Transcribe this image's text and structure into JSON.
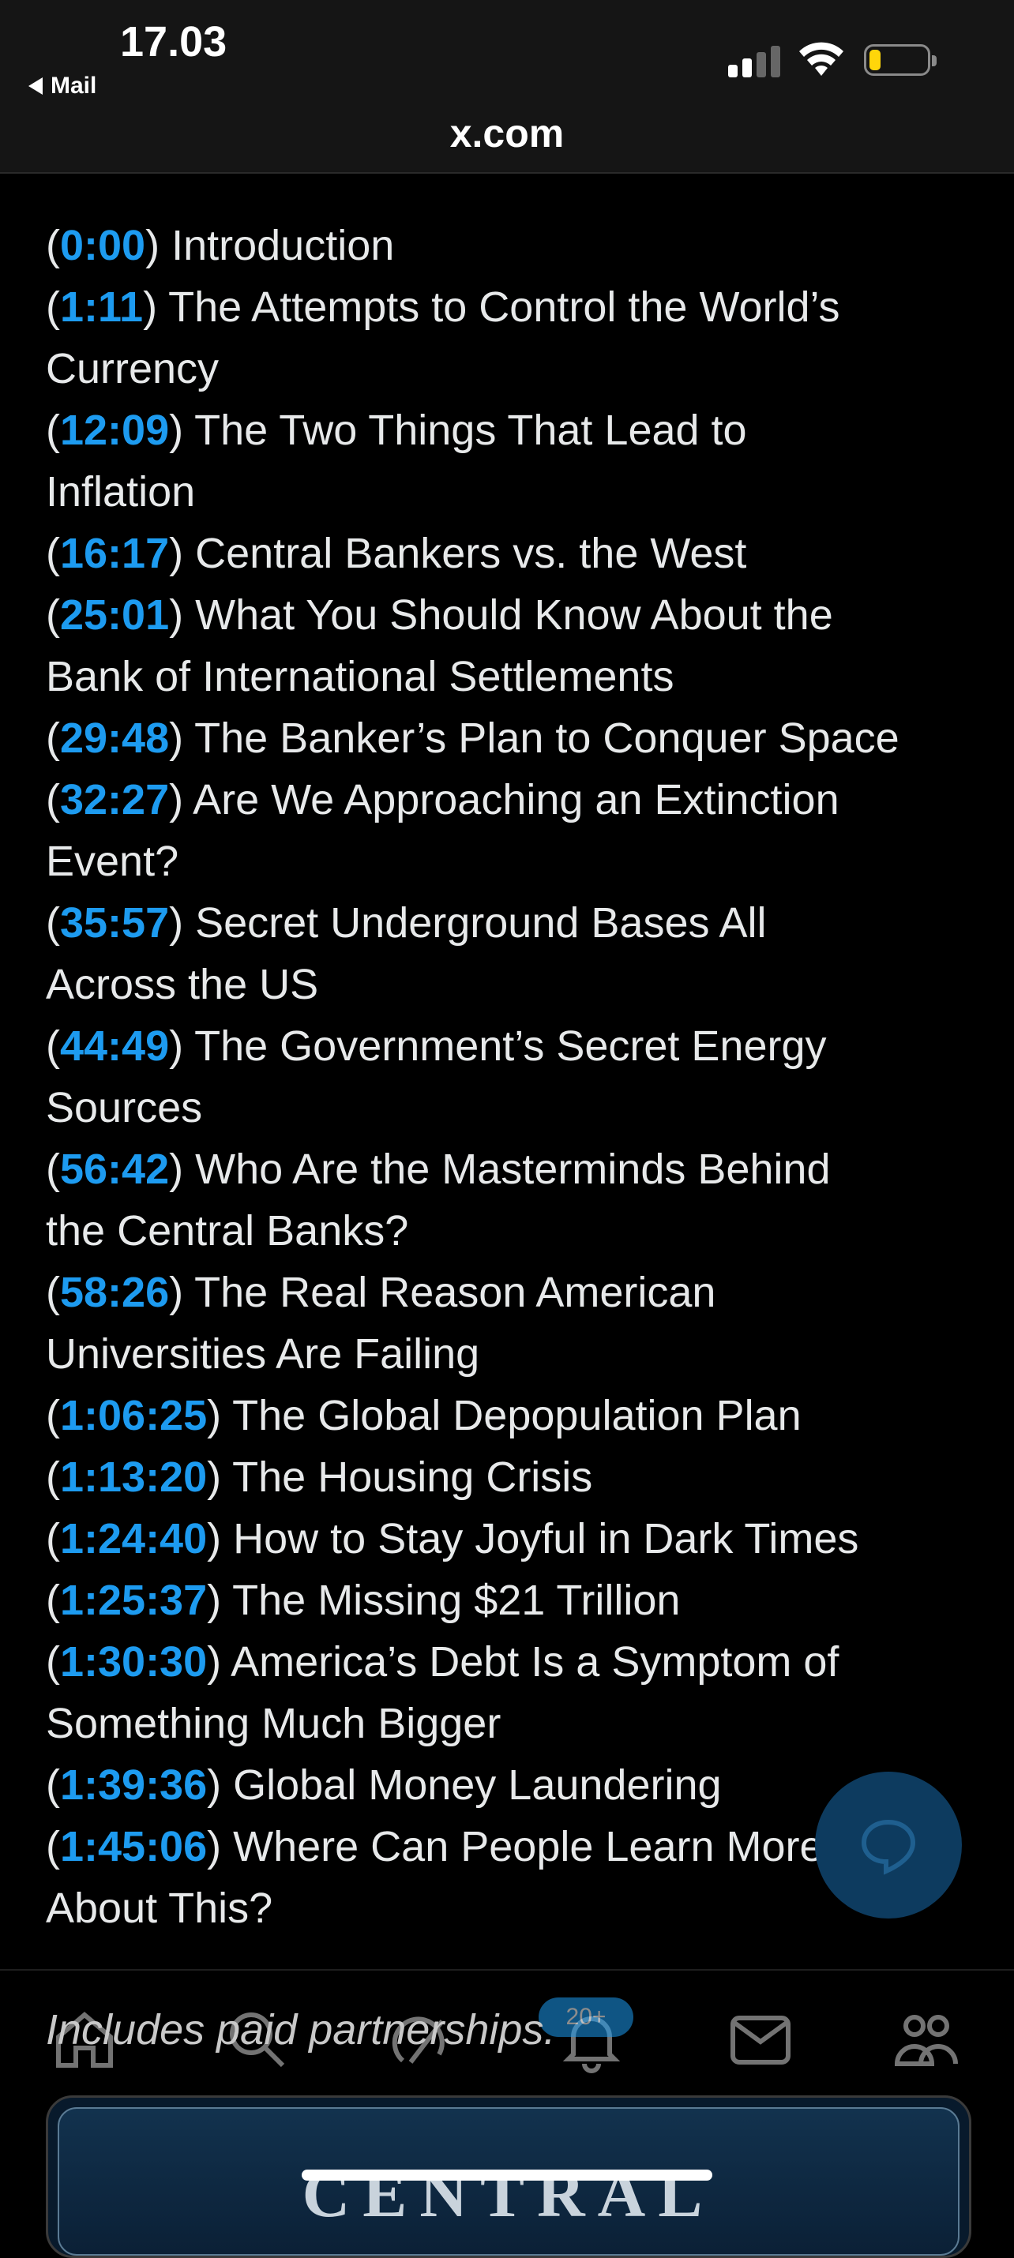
{
  "status_bar": {
    "time": "17.03",
    "back_app": "Mail"
  },
  "browser": {
    "url": "x.com"
  },
  "timestamps": [
    {
      "time": "0:00",
      "lines": [
        "Introduction"
      ]
    },
    {
      "time": "1:11",
      "lines": [
        "The Attempts to Control the World’s",
        "Currency"
      ]
    },
    {
      "time": "12:09",
      "lines": [
        "The Two Things That Lead to",
        "Inflation"
      ]
    },
    {
      "time": "16:17",
      "lines": [
        "Central Bankers vs. the West"
      ]
    },
    {
      "time": "25:01",
      "lines": [
        "What You Should Know About the",
        "Bank of International Settlements"
      ]
    },
    {
      "time": "29:48",
      "lines": [
        "The Banker’s Plan to Conquer Space"
      ]
    },
    {
      "time": "32:27",
      "lines": [
        "Are We Approaching an Extinction",
        "Event?"
      ]
    },
    {
      "time": "35:57",
      "lines": [
        "Secret Underground Bases All",
        "Across the US"
      ]
    },
    {
      "time": "44:49",
      "lines": [
        "The Government’s Secret Energy",
        "Sources"
      ]
    },
    {
      "time": "56:42",
      "lines": [
        "Who Are the Masterminds Behind",
        "the Central Banks?"
      ]
    },
    {
      "time": "58:26",
      "lines": [
        "The Real Reason American",
        "Universities Are Failing"
      ]
    },
    {
      "time": "1:06:25",
      "lines": [
        "The Global Depopulation Plan"
      ]
    },
    {
      "time": "1:13:20",
      "lines": [
        "The Housing Crisis"
      ]
    },
    {
      "time": "1:24:40",
      "lines": [
        "How to Stay Joyful in Dark Times"
      ]
    },
    {
      "time": "1:25:37",
      "lines": [
        "The Missing $21 Trillion"
      ]
    },
    {
      "time": "1:30:30",
      "lines": [
        "America’s Debt Is a Symptom of",
        "Something Much Bigger"
      ]
    },
    {
      "time": "1:39:36",
      "lines": [
        "Global Money Laundering"
      ]
    },
    {
      "time": "1:45:06",
      "lines": [
        "Where Can People Learn More",
        "About This?"
      ]
    }
  ],
  "disclosure": "Includes paid partnerships.",
  "nav": {
    "badge": "20+",
    "icons": [
      "home-icon",
      "search-icon",
      "grok-icon",
      "notifications-icon",
      "messages-icon",
      "communities-icon"
    ]
  },
  "fab_icon": "reply-bubble-icon",
  "card": {
    "headline": "CENTRAL"
  },
  "colors": {
    "link": "#1d9bf0",
    "background": "#000000",
    "text": "#e7e9ea"
  }
}
